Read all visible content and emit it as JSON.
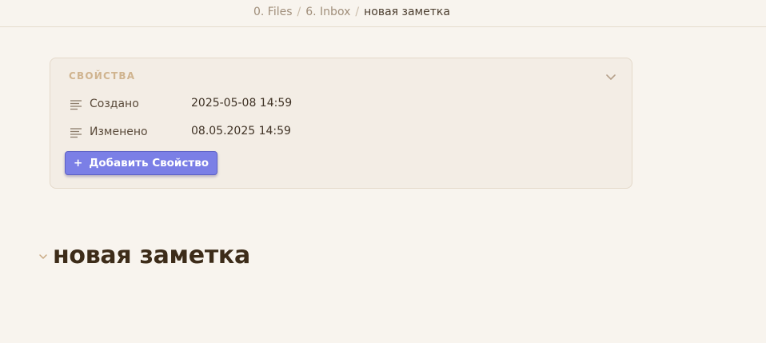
{
  "breadcrumb": {
    "items": [
      "0. Files",
      "6. Inbox"
    ],
    "separator": "/",
    "current": "новая заметка"
  },
  "properties": {
    "title": "СВОЙСТВА",
    "rows": [
      {
        "key": "Создано",
        "value": "2025-05-08 14:59",
        "icon": "text-lines-icon"
      },
      {
        "key": "Изменено",
        "value": "08.05.2025 14:59",
        "icon": "text-lines-icon"
      }
    ],
    "add_button": {
      "icon": "+",
      "label": "Добавить Свойство"
    }
  },
  "note": {
    "heading": "новая заметка"
  },
  "colors": {
    "background": "#f8f4ee",
    "panel": "#f3ede5",
    "accent_button": "#7b7fe6",
    "properties_title": "#d0b48f",
    "heading": "#3d2c19"
  }
}
